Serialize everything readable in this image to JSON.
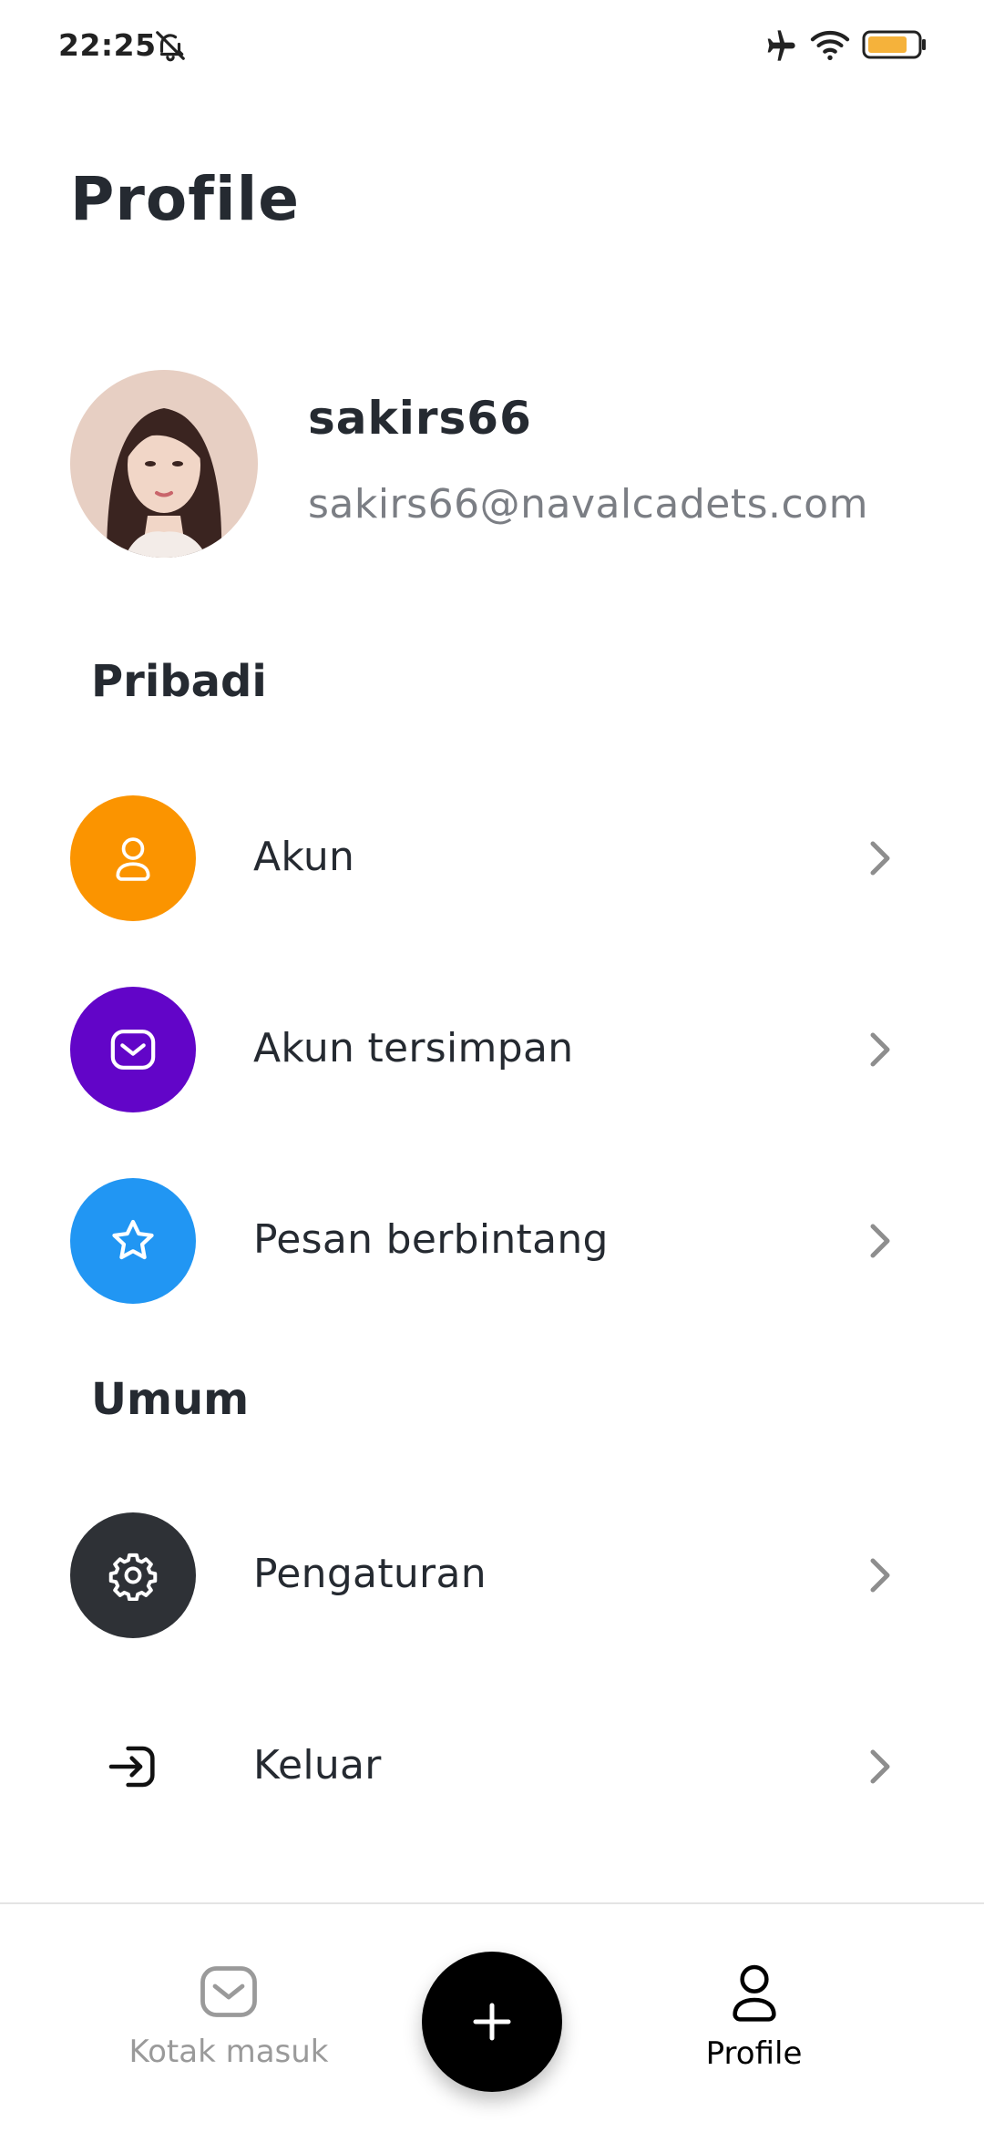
{
  "status_bar": {
    "time": "22:25",
    "icons": [
      "bell-off-icon",
      "airplane-icon",
      "wifi-icon",
      "battery-icon"
    ],
    "battery_color": "#f5b23b"
  },
  "page": {
    "title": "Profile"
  },
  "profile": {
    "username": "sakirs66",
    "email": "sakirs66@navalcadets.com",
    "avatar": "avatar-photo"
  },
  "sections": {
    "personal": {
      "title": "Pribadi",
      "items": [
        {
          "label": "Akun",
          "icon": "user-icon",
          "color": "#fb9400"
        },
        {
          "label": "Akun tersimpan",
          "icon": "mail-icon",
          "color": "#6205c8"
        },
        {
          "label": "Pesan berbintang",
          "icon": "star-icon",
          "color": "#2196f3"
        }
      ]
    },
    "general": {
      "title": "Umum",
      "items": [
        {
          "label": "Pengaturan",
          "icon": "gear-icon",
          "color": "#2e3136"
        },
        {
          "label": "Keluar",
          "icon": "logout-icon",
          "color": "#ffffff"
        }
      ]
    }
  },
  "bottom_nav": {
    "inbox_label": "Kotak masuk",
    "profile_label": "Profile",
    "fab_icon": "plus-icon",
    "active_color": "#000000",
    "inactive_color": "#9a9a9a"
  }
}
